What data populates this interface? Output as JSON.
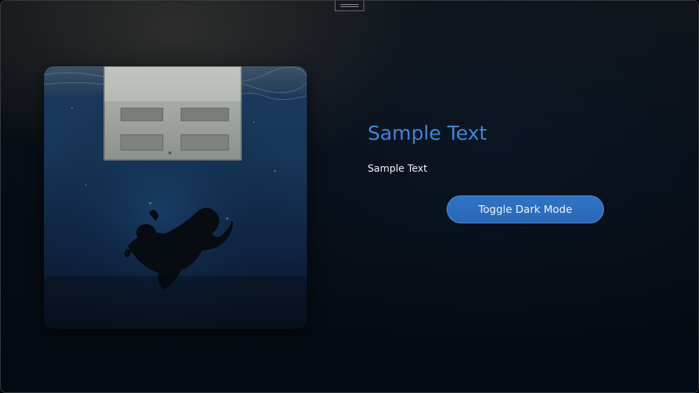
{
  "heading": "Sample Text",
  "body_text": "Sample Text",
  "toggle_button": {
    "label": "Toggle Dark Mode"
  },
  "colors": {
    "accent": "#3f86d6",
    "button": "#2f6fc0",
    "background": "#050b14",
    "text": "#f2f4f7"
  },
  "icons": [
    "drag-handle-icon"
  ]
}
